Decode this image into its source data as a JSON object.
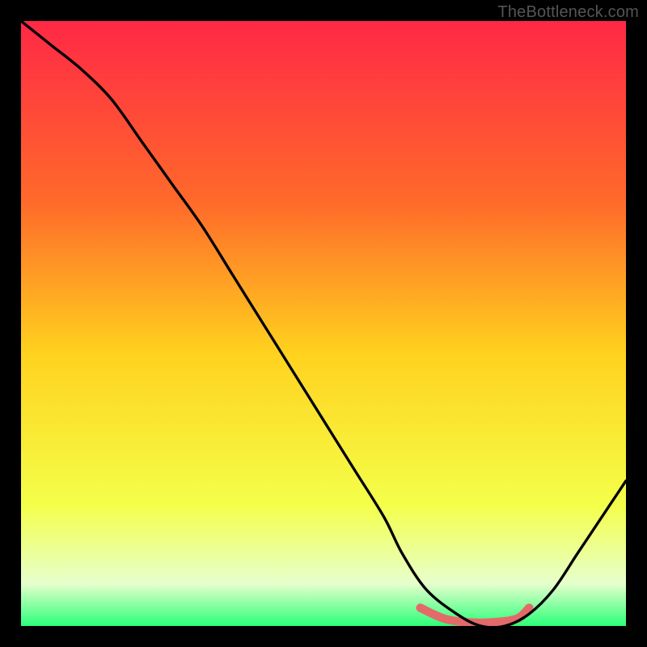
{
  "credit": "TheBottleneck.com",
  "colors": {
    "bg": "#000000",
    "grad_top": "#ff2846",
    "grad_upper_mid": "#ff6a2a",
    "grad_mid": "#ffd21e",
    "grad_lower_mid": "#f4ff4a",
    "grad_bottom_light": "#e6ffcc",
    "grad_bottom": "#2cff7a",
    "curve": "#000000",
    "band": "#e46a6a"
  },
  "chart_data": {
    "type": "line",
    "title": "",
    "xlabel": "",
    "ylabel": "",
    "xlim": [
      0,
      100
    ],
    "ylim": [
      0,
      100
    ],
    "series": [
      {
        "name": "bottleneck-curve",
        "x": [
          0,
          5,
          10,
          15,
          20,
          25,
          30,
          35,
          40,
          45,
          50,
          55,
          60,
          63,
          67,
          72,
          76,
          80,
          84,
          88,
          92,
          96,
          100
        ],
        "y": [
          100,
          96,
          92,
          87,
          80,
          73,
          66,
          58,
          50,
          42,
          34,
          26,
          18,
          12,
          6,
          2,
          0,
          0,
          2,
          6,
          12,
          18,
          24
        ]
      },
      {
        "name": "optimal-band",
        "x": [
          66,
          70,
          74,
          78,
          82,
          84
        ],
        "y": [
          3,
          1.2,
          0.6,
          0.6,
          1.2,
          3
        ]
      }
    ],
    "annotations": []
  }
}
